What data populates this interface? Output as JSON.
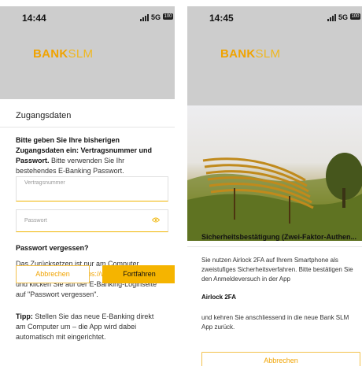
{
  "left": {
    "status": {
      "time": "14:44",
      "network": "5G",
      "battery": "100"
    },
    "logo": {
      "bold": "BANK",
      "light": "SLM"
    },
    "sheet_title": "Zugangsdaten",
    "intro_bold": "Bitte geben Sie Ihre bisherigen Zugangsdaten ein: Vertragsnummer und Passwort.",
    "intro_rest": " Bitte verwenden Sie Ihr bestehendes E-Banking Passwort.",
    "contract_placeholder": "Vertragsnummer",
    "password_placeholder": "Passwort",
    "forgot_heading": "Passwort vergessen?",
    "forgot_text_1": "Das Zurücksetzen ist nur am Computer möglich. Öffnen Sie ",
    "forgot_link": "https://www.bankslm.ch",
    "forgot_text_2": " und klicken Sie auf der E-Banking-Loginseite auf \"Passwort vergessen\".",
    "tip_label": "Tipp:",
    "tip_text": " Stellen Sie das neue E-Banking direkt am Computer um – die App wird dabei automatisch mit eingerichtet.",
    "cancel_label": "Abbrechen",
    "continue_label": "Fortfahren"
  },
  "right": {
    "status": {
      "time": "14:45",
      "network": "5G",
      "battery": "100"
    },
    "logo": {
      "bold": "BANK",
      "light": "SLM"
    },
    "title": "Sicherheitsbestätigung (Zwei-Faktor-Authen...",
    "body": "Sie nutzen Airlock 2FA auf Ihrem Smartphone als zweistufiges Sicherheitsverfahren. Bitte bestätigen Sie den Anmeldeversuch in der App",
    "app_name": "Airlock 2FA",
    "body2": "und kehren Sie anschliessend in die neue Bank SLM App zurück.",
    "cancel_label": "Abbrechen"
  },
  "colors": {
    "accent": "#f5b400",
    "accent_text": "#f0a300",
    "dim": "#cdcdcd"
  },
  "icons": {
    "password_toggle": "eye-icon",
    "signal": "signal-icon",
    "battery": "battery-icon"
  }
}
